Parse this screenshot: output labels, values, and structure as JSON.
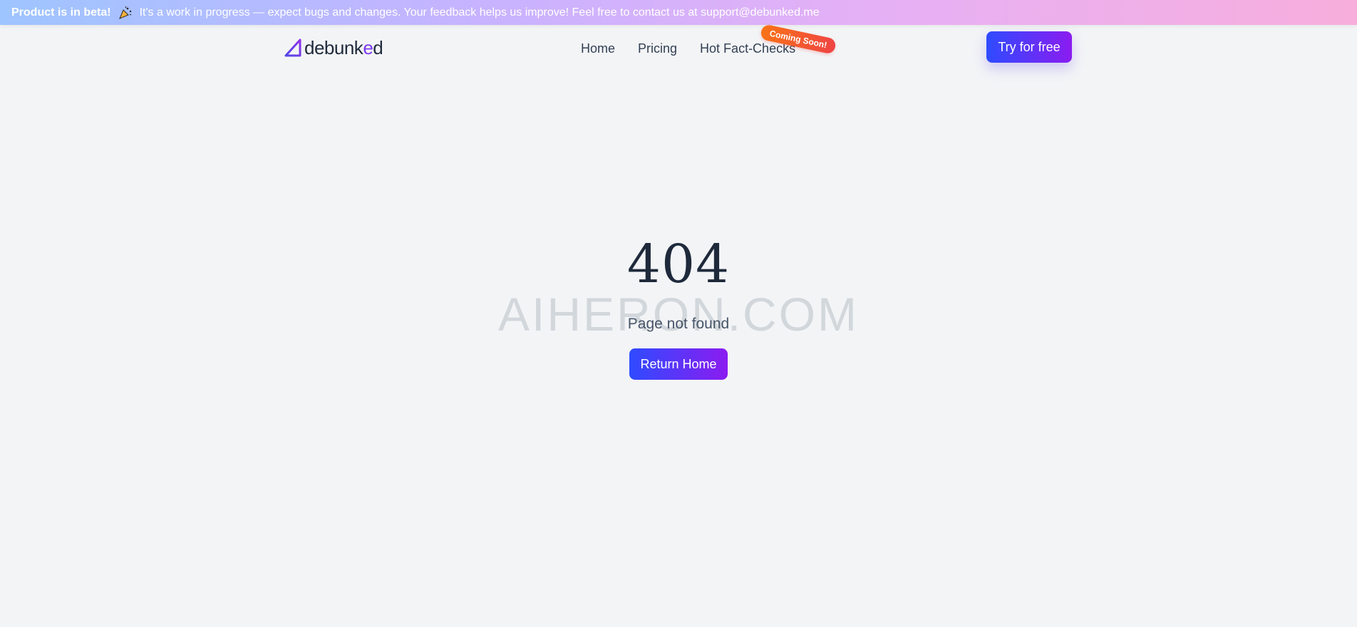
{
  "banner": {
    "strong": "Product is in beta!",
    "icon": "party-popper-icon",
    "text": "It's a work in progress — expect bugs and changes. Your feedback helps us improve! Feel free to contact us at support@debunked.me"
  },
  "header": {
    "logo_prefix": "debunk",
    "logo_accent": "e",
    "logo_suffix": "d",
    "nav": [
      {
        "label": "Home"
      },
      {
        "label": "Pricing"
      },
      {
        "label": "Hot Fact-Checks",
        "badge": "Coming Soon!"
      }
    ],
    "cta_label": "Try for free"
  },
  "main": {
    "code": "404",
    "watermark": "AIHERON.COM",
    "subtitle": "Page not found",
    "return_label": "Return Home"
  },
  "colors": {
    "accent_start": "#2f4bff",
    "accent_end": "#8b1cf0",
    "badge_start": "#f97316",
    "badge_end": "#ef4444",
    "background": "#f3f4f6"
  }
}
